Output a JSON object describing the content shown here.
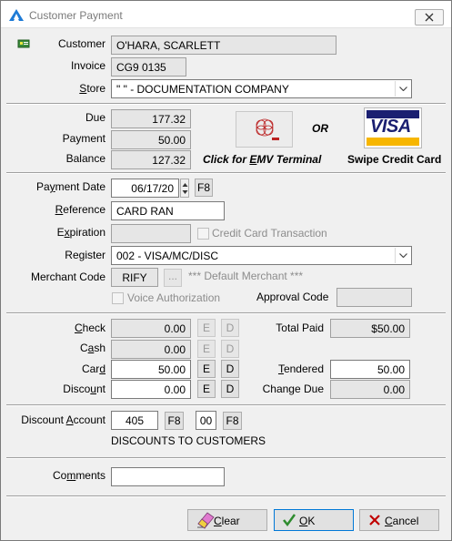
{
  "window": {
    "title": "Customer Payment"
  },
  "header": {
    "customer_label": "Customer",
    "customer_value": "O'HARA, SCARLETT",
    "invoice_label": "Invoice",
    "invoice_value": "CG9 0135",
    "store_label": "Store",
    "store_value": "\" \" - DOCUMENTATION COMPANY"
  },
  "amounts": {
    "due_label": "Due",
    "due_value": "177.32",
    "payment_label": "Payment",
    "payment_value": "50.00",
    "balance_label": "Balance",
    "balance_value": "127.32"
  },
  "card_options": {
    "emv_label": "Click for EMV Terminal",
    "or_label": "OR",
    "swipe_label": "Swipe Credit Card",
    "visa_text": "VISA"
  },
  "payment": {
    "date_label": "Payment Date",
    "date_value": "06/17/20",
    "f8_label": "F8",
    "reference_label": "Reference",
    "reference_value": "CARD RAN",
    "expiration_label": "Expiration",
    "expiration_value": "",
    "cc_transaction_label": "Credit Card Transaction",
    "register_label": "Register",
    "register_value": "002 - VISA/MC/DISC",
    "merchant_label": "Merchant Code",
    "merchant_value": "RIFY",
    "merchant_lookup_label": "...",
    "merchant_default_label": "*** Default Merchant ***",
    "voice_auth_label": "Voice Authorization",
    "approval_label": "Approval Code",
    "approval_value": ""
  },
  "tender": {
    "check_label": "Check",
    "check_value": "0.00",
    "cash_label": "Cash",
    "cash_value": "0.00",
    "card_label": "Card",
    "card_value": "50.00",
    "discount_label": "Discount",
    "discount_value": "0.00",
    "e_label": "E",
    "d_label": "D",
    "total_paid_label": "Total Paid",
    "total_paid_value": "$50.00",
    "tendered_label": "Tendered",
    "tendered_value": "50.00",
    "change_due_label": "Change Due",
    "change_due_value": "0.00"
  },
  "discount": {
    "account_label": "Discount Account",
    "account_value": "405",
    "sub_value": "00",
    "f8_label": "F8",
    "description": "DISCOUNTS TO CUSTOMERS"
  },
  "comments": {
    "label": "Comments",
    "value": ""
  },
  "buttons": {
    "clear": "Clear",
    "ok": "OK",
    "cancel": "Cancel"
  },
  "colors": {
    "visa_blue": "#1a1f71",
    "visa_gold": "#f7b600",
    "ok_check": "#2e8b2e",
    "cancel_x": "#c00000"
  }
}
